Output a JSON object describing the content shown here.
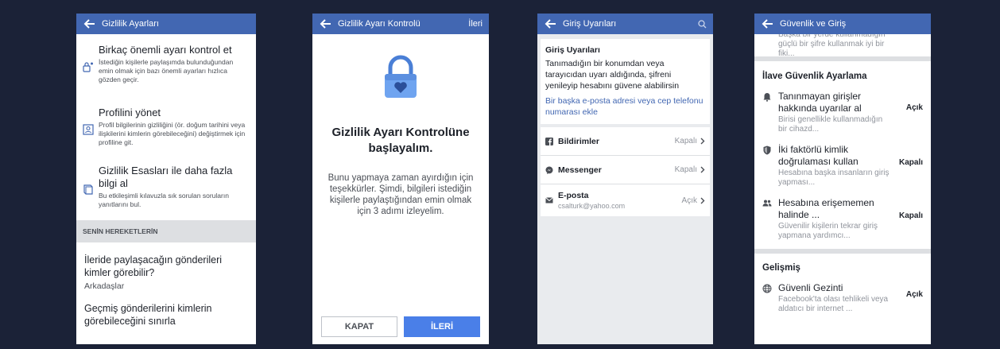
{
  "colors": {
    "page_bg": "#1b2237",
    "brand": "#4267b2",
    "section_gray": "#dddfe2",
    "link": "#4267b2"
  },
  "screen1": {
    "title": "Gizlilik Ayarları",
    "items": [
      {
        "icon": "user-lock-icon",
        "title": "Birkaç önemli ayarı kontrol et",
        "desc": "İstediğin kişilerle paylaşımda bulunduğundan emin olmak için bazı önemli ayarları hızlıca gözden geçir."
      },
      {
        "icon": "profile-card-icon",
        "title": "Profilini yönet",
        "desc": "Profil bilgilerinin gizliliğini (ör. doğum tarihini veya ilişkilerini kimlerin görebileceğini) değiştirmek için profiline git."
      },
      {
        "icon": "book-icon",
        "title": "Gizlilik Esasları ile daha fazla bilgi al",
        "desc": "Bu etkileşimli kılavuzla sık sorulan soruların yanıtlarını bul."
      }
    ],
    "section_header": "SENİN HEREKETLERİN",
    "activity": [
      {
        "title": "İleride paylaşacağın gönderileri kimler görebilir?",
        "value": "Arkadaşlar"
      },
      {
        "title": "Geçmiş gönderilerini kimlerin görebileceğini sınırla"
      }
    ]
  },
  "screen2": {
    "title": "Gizlilik Ayarı Kontrolü",
    "next_top": "İleri",
    "icon": "heart-lock-icon",
    "heading": "Gizlilik Ayarı Kontrolüne başlayalım.",
    "body": "Bunu yapmaya zaman ayırdığın için teşekkürler. Şimdi, bilgileri istediğin kişilerle paylaştığından emin olmak için 3 adımı izleyelim.",
    "close_button": "KAPAT",
    "next_button": "İLERİ"
  },
  "screen3": {
    "title": "Giriş Uyarıları",
    "search_icon": "search-icon",
    "card_title": "Giriş Uyarıları",
    "card_body": "Tanımadığın bir konumdan veya tarayıcıdan uyarı aldığında, şifreni yenileyip hesabını güvene alabilirsin",
    "card_link": "Bir başka e-posta adresi veya cep telefonu numarası ekle",
    "rows": [
      {
        "icon": "facebook-icon",
        "label": "Bildirimler",
        "value": "Kapalı"
      },
      {
        "icon": "messenger-icon",
        "label": "Messenger",
        "value": "Kapalı"
      },
      {
        "icon": "mail-icon",
        "label": "E-posta",
        "sub": "csalturk@yahoo.com",
        "value": "Açık"
      }
    ]
  },
  "screen4": {
    "title": "Güvenlik ve Giriş",
    "top_text": "Başka bir yerde kullanmadığın güçlü bir şifre kullanmak iyi bir fiki...",
    "section1": "İlave Güvenlik Ayarlama",
    "items": [
      {
        "icon": "bell-icon",
        "title": "Tanınmayan girişler hakkında uyarılar al",
        "desc": "Birisi genellikle kullanmadığın bir cihazd...",
        "state": "Açık"
      },
      {
        "icon": "shield-icon",
        "title": "İki faktörlü kimlik doğrulaması kullan",
        "desc": "Hesabına başka insanların giriş yapması...",
        "state": "Kapalı"
      },
      {
        "icon": "friends-icon",
        "title": "Hesabına erişememen halinde ...",
        "desc": "Güvenilir kişilerin tekrar giriş yapmana yardımcı...",
        "state": "Kapalı"
      }
    ],
    "section2": "Gelişmiş",
    "adv": {
      "icon": "globe-icon",
      "title": "Güvenli Gezinti",
      "desc": "Facebook'ta olası tehlikeli veya aldatıcı bir internet ...",
      "state": "Açık"
    }
  }
}
